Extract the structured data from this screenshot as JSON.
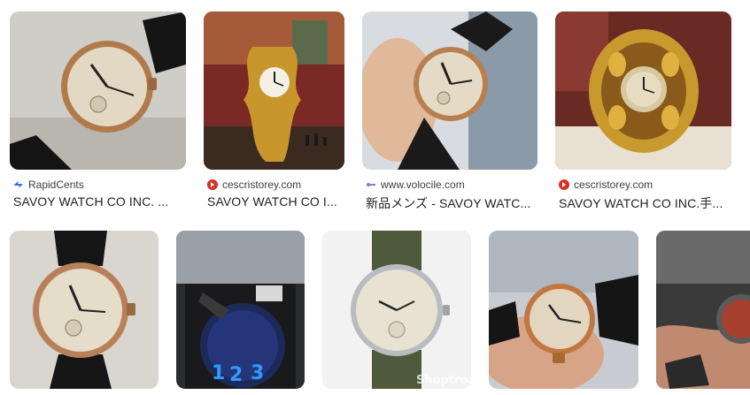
{
  "results_row1": [
    {
      "source": "RapidCents",
      "caption": "SAVOY WATCH CO INC. ...",
      "favicon": "rapidcents-icon"
    },
    {
      "source": "cescristorey.com",
      "caption": "SAVOY WATCH CO I...",
      "favicon": "cescristorey-icon"
    },
    {
      "source": "www.volocile.com",
      "caption": "新品メンズ - SAVOY WATC...",
      "favicon": "volocile-icon"
    },
    {
      "source": "cescristorey.com",
      "caption": "SAVOY WATCH CO INC.手...",
      "favicon": "cescristorey-icon"
    }
  ],
  "results_row2": [
    {
      "image": "rose-gold-watch-black-strap"
    },
    {
      "image": "watch-in-box-blue-numerals"
    },
    {
      "image": "eterna-silver-watch-green-strap",
      "watermark": "Shoptroa"
    },
    {
      "image": "gold-watch-held-in-hand"
    },
    {
      "image": "watch-on-wrist-partial"
    }
  ],
  "colors": {
    "text": "#1f1f1f",
    "source_text": "#3c4043",
    "cescristorey_red": "#d93025",
    "rapidcents_blue": "#1a73e8"
  }
}
